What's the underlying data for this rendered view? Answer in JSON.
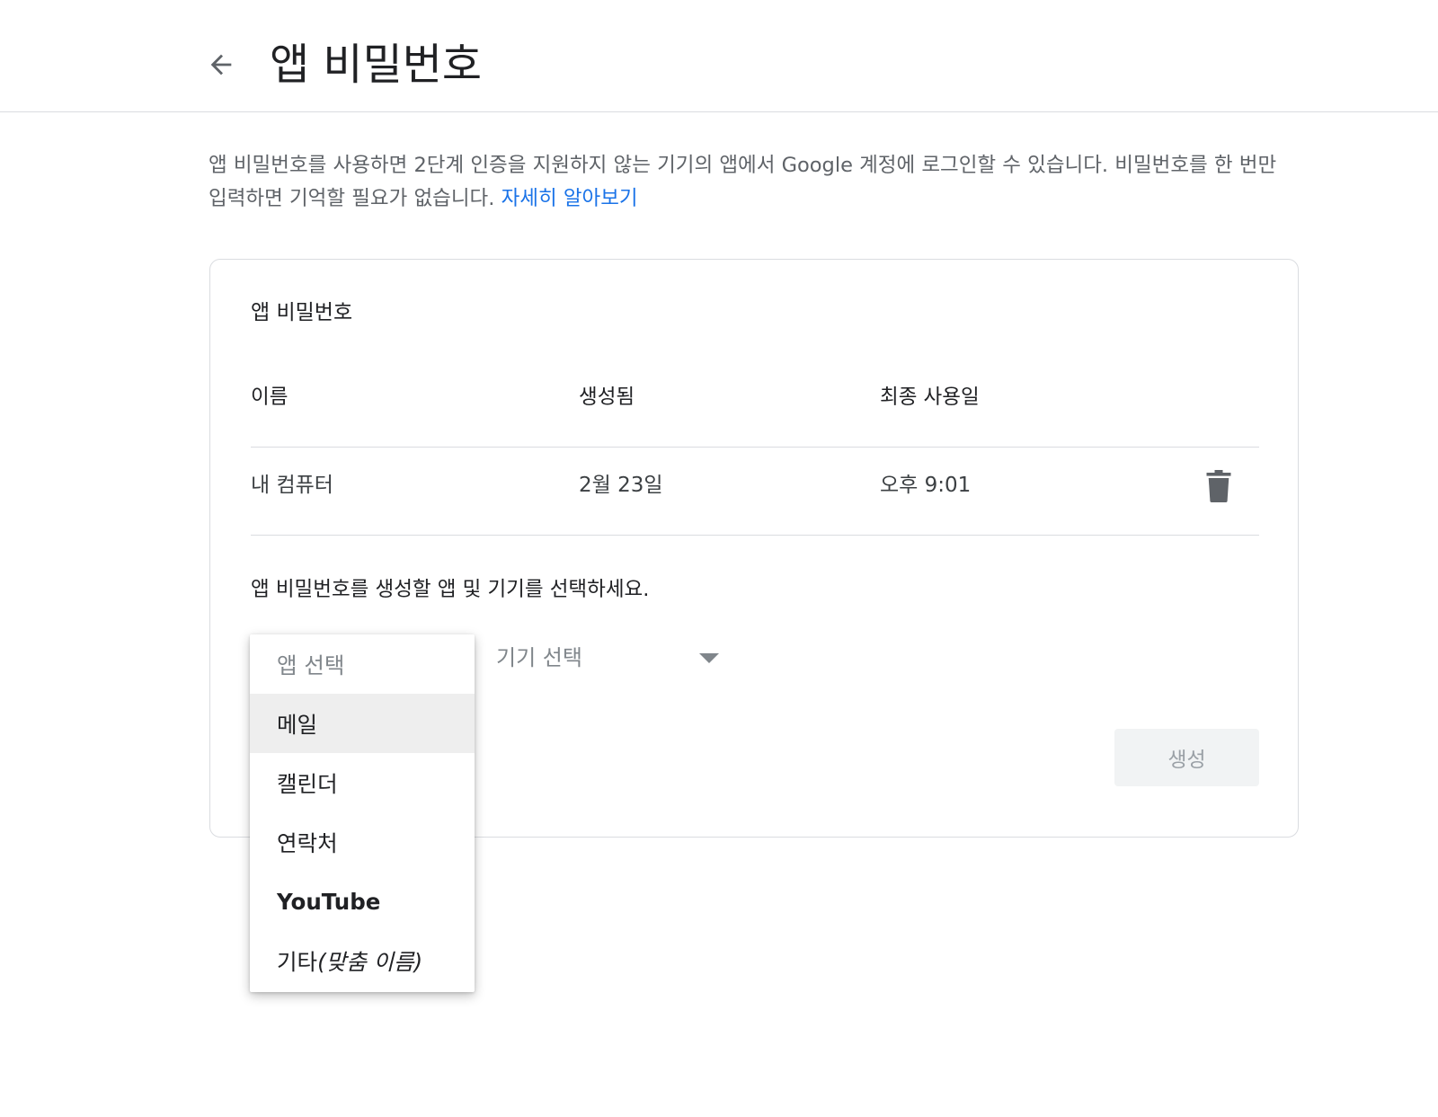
{
  "header": {
    "title": "앱 비밀번호",
    "back_icon": "arrow-back-icon"
  },
  "intro": {
    "text": "앱 비밀번호를 사용하면 2단계 인증을 지원하지 않는 기기의 앱에서 Google 계정에 로그인할 수 있습니다. 비밀번호를 한 번만 입력하면 기억할 필요가 없습니다.",
    "link": "자세히 알아보기"
  },
  "card": {
    "title": "앱 비밀번호",
    "columns": {
      "name": "이름",
      "created": "생성됨",
      "last_used": "최종 사용일"
    },
    "rows": [
      {
        "name": "내 컴퓨터",
        "created": "2월 23일",
        "last_used": "오후 9:01",
        "action_icon": "trash-icon"
      }
    ],
    "prompt": "앱 비밀번호를 생성할 앱 및 기기를 선택하세요.",
    "app_select": {
      "placeholder": "앱 선택",
      "options": [
        {
          "label": "메일"
        },
        {
          "label": "캘린더"
        },
        {
          "label": "연락처"
        },
        {
          "label": "YouTube"
        },
        {
          "label": "기타",
          "suffix": "(맞춤 이름)"
        }
      ],
      "highlighted": "메일"
    },
    "device_select": {
      "placeholder": "기기 선택"
    },
    "generate_label": "생성"
  },
  "colors": {
    "link": "#1a73e8",
    "text": "#202124",
    "secondary_text": "#5f6368",
    "divider": "#dadce0",
    "disabled_button_bg": "#f1f3f4",
    "highlight_bg": "#eeeeee"
  }
}
